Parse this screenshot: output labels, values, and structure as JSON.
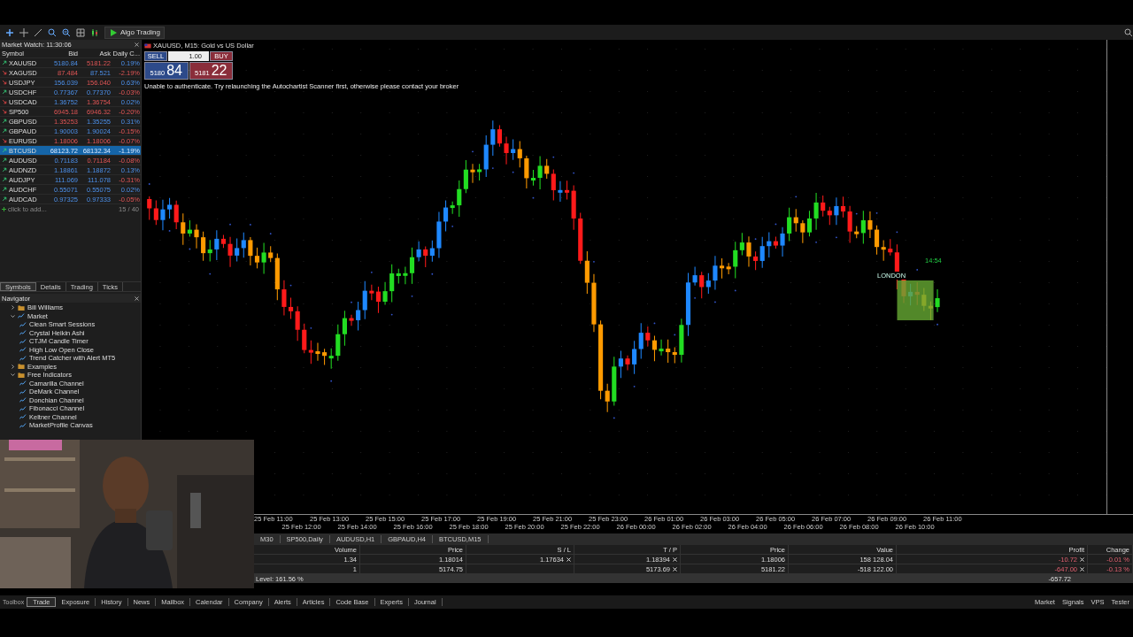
{
  "toolbar": {
    "algo_trading": "Algo Trading"
  },
  "market_watch": {
    "title": "Market Watch: 11:30:06",
    "columns": [
      "Symbol",
      "Bid",
      "Ask",
      "Daily C..."
    ],
    "rows": [
      {
        "symbol": "XAUUSD",
        "bid": "5180.84",
        "ask": "5181.22",
        "change": "0.19%",
        "rising": true,
        "bid_up": true,
        "ask_up": false,
        "change_up": true,
        "selected": false
      },
      {
        "symbol": "XAGUSD",
        "bid": "87.484",
        "ask": "87.521",
        "change": "-2.19%",
        "rising": false,
        "bid_up": false,
        "ask_up": true,
        "change_up": false,
        "selected": false
      },
      {
        "symbol": "USDJPY",
        "bid": "156.039",
        "ask": "156.040",
        "change": "0.63%",
        "rising": false,
        "bid_up": true,
        "ask_up": false,
        "change_up": true,
        "selected": false
      },
      {
        "symbol": "USDCHF",
        "bid": "0.77367",
        "ask": "0.77370",
        "change": "-0.03%",
        "rising": true,
        "bid_up": true,
        "ask_up": true,
        "change_up": false,
        "selected": false
      },
      {
        "symbol": "USDCAD",
        "bid": "1.36752",
        "ask": "1.36754",
        "change": "0.02%",
        "rising": false,
        "bid_up": true,
        "ask_up": false,
        "change_up": true,
        "selected": false
      },
      {
        "symbol": "SP500",
        "bid": "6945.18",
        "ask": "6946.32",
        "change": "-0.20%",
        "rising": false,
        "bid_up": false,
        "ask_up": false,
        "change_up": false,
        "selected": false
      },
      {
        "symbol": "GBPUSD",
        "bid": "1.35253",
        "ask": "1.35255",
        "change": "0.31%",
        "rising": true,
        "bid_up": false,
        "ask_up": true,
        "change_up": true,
        "selected": false
      },
      {
        "symbol": "GBPAUD",
        "bid": "1.90003",
        "ask": "1.90024",
        "change": "-0.15%",
        "rising": true,
        "bid_up": true,
        "ask_up": true,
        "change_up": false,
        "selected": false
      },
      {
        "symbol": "EURUSD",
        "bid": "1.18006",
        "ask": "1.18006",
        "change": "-0.07%",
        "rising": false,
        "bid_up": false,
        "ask_up": false,
        "change_up": false,
        "selected": false
      },
      {
        "symbol": "BTCUSD",
        "bid": "68123.72",
        "ask": "68132.34",
        "change": "-1.19%",
        "rising": true,
        "bid_up": true,
        "ask_up": true,
        "change_up": false,
        "selected": true
      },
      {
        "symbol": "AUDUSD",
        "bid": "0.71183",
        "ask": "0.71184",
        "change": "-0.08%",
        "rising": true,
        "bid_up": true,
        "ask_up": false,
        "change_up": false,
        "selected": false
      },
      {
        "symbol": "AUDNZD",
        "bid": "1.18861",
        "ask": "1.18872",
        "change": "0.13%",
        "rising": true,
        "bid_up": true,
        "ask_up": true,
        "change_up": true,
        "selected": false
      },
      {
        "symbol": "AUDJPY",
        "bid": "111.069",
        "ask": "111.078",
        "change": "-0.31%",
        "rising": true,
        "bid_up": true,
        "ask_up": true,
        "change_up": false,
        "selected": false
      },
      {
        "symbol": "AUDCHF",
        "bid": "0.55071",
        "ask": "0.55075",
        "change": "0.02%",
        "rising": true,
        "bid_up": true,
        "ask_up": true,
        "change_up": true,
        "selected": false
      },
      {
        "symbol": "AUDCAD",
        "bid": "0.97325",
        "ask": "0.97333",
        "change": "-0.05%",
        "rising": true,
        "bid_up": true,
        "ask_up": true,
        "change_up": false,
        "selected": false
      }
    ],
    "add_hint": "click to add...",
    "count": "15 / 40"
  },
  "panel_tabs": [
    {
      "label": "Symbols",
      "selected": true
    },
    {
      "label": "Details",
      "selected": false
    },
    {
      "label": "Trading",
      "selected": false
    },
    {
      "label": "Ticks",
      "selected": false
    }
  ],
  "navigator": {
    "title": "Navigator",
    "items": [
      {
        "label": "Bill Williams",
        "kind": "folder",
        "expanded": false
      },
      {
        "label": "Market",
        "kind": "market",
        "expanded": true,
        "children": [
          {
            "label": "Clean Smart Sessions",
            "kind": "indicator"
          },
          {
            "label": "Crystal Heikin Ashi",
            "kind": "indicator"
          },
          {
            "label": "CTJM Candle Timer",
            "kind": "indicator"
          },
          {
            "label": "High Low Open Close",
            "kind": "indicator"
          },
          {
            "label": "Trend Catcher with Alert MT5",
            "kind": "indicator"
          }
        ]
      },
      {
        "label": "Examples",
        "kind": "folder",
        "expanded": false
      },
      {
        "label": "Free Indicators",
        "kind": "folder",
        "expanded": true,
        "children": [
          {
            "label": "Camarilla Channel",
            "kind": "indicator"
          },
          {
            "label": "DeMark Channel",
            "kind": "indicator"
          },
          {
            "label": "Donchian Channel",
            "kind": "indicator"
          },
          {
            "label": "Fibonacci Channel",
            "kind": "indicator"
          },
          {
            "label": "Keltner Channel",
            "kind": "indicator"
          },
          {
            "label": "MarketProfile Canvas",
            "kind": "indicator"
          }
        ]
      }
    ]
  },
  "chart": {
    "title": "XAUUSD, M15:  Gold vs US Dollar",
    "one_click": {
      "sell": "SELL",
      "buy": "BUY",
      "volume": "1.00",
      "sell_big": "5180",
      "sell_pips": "84",
      "buy_big": "5181",
      "buy_pips": "22"
    },
    "message": "Unable to authenticate. Try relaunching the Autochartist Scanner first, otherwise please contact your broker",
    "session_label": "LONDON",
    "session_time": "14:54",
    "time_labels": [
      "25 Feb 11:00",
      "25 Feb 12:00",
      "25 Feb 13:00",
      "25 Feb 14:00",
      "25 Feb 15:00",
      "25 Feb 16:00",
      "25 Feb 17:00",
      "25 Feb 18:00",
      "25 Feb 19:00",
      "25 Feb 20:00",
      "25 Feb 21:00",
      "25 Feb 22:00",
      "25 Feb 23:00",
      "26 Feb 00:00",
      "26 Feb 01:00",
      "26 Feb 02:00",
      "26 Feb 03:00",
      "26 Feb 04:00",
      "26 Feb 05:00",
      "26 Feb 06:00",
      "26 Feb 07:00",
      "26 Feb 08:00",
      "26 Feb 09:00",
      "26 Feb 10:00",
      "26 Feb 11:00"
    ]
  },
  "chart_tabs": [
    "M30",
    "SP500,Daily",
    "AUDUSD,H1",
    "GBPAUD,H4",
    "BTCUSD,M15"
  ],
  "trade": {
    "columns": [
      "Volume",
      "Price",
      "S / L",
      "T / P",
      "Price",
      "Value",
      "Profit",
      "Change"
    ],
    "rows": [
      {
        "volume": "1.34",
        "price": "1.18014",
        "sl": "1.17634",
        "tp": "1.18394",
        "current": "1.18006",
        "value": "158 128.04",
        "profit": "-10.72",
        "change": "-0.01 %"
      },
      {
        "volume": "1",
        "price": "5174.75",
        "tp": "5173.69",
        "current": "5181.22",
        "value": "-518 122.00",
        "profit": "-647.00",
        "change": "-0.13 %"
      }
    ],
    "level": "Level: 161.56 %",
    "total": "-657.72"
  },
  "toolbox_label": "Toolbox",
  "bottom_tabs": [
    {
      "label": "Trade",
      "selected": true
    },
    {
      "label": "Exposure",
      "selected": false
    },
    {
      "label": "History",
      "selected": false
    },
    {
      "label": "News",
      "selected": false
    },
    {
      "label": "Mailbox",
      "selected": false
    },
    {
      "label": "Calendar",
      "selected": false
    },
    {
      "label": "Company",
      "selected": false
    },
    {
      "label": "Alerts",
      "selected": false
    },
    {
      "label": "Articles",
      "selected": false
    },
    {
      "label": "Code Base",
      "selected": false
    },
    {
      "label": "Experts",
      "selected": false
    },
    {
      "label": "Journal",
      "selected": false
    }
  ],
  "right_links": [
    "Market",
    "Signals",
    "VPS",
    "Tester"
  ],
  "webcam": {
    "kind": "picture"
  }
}
